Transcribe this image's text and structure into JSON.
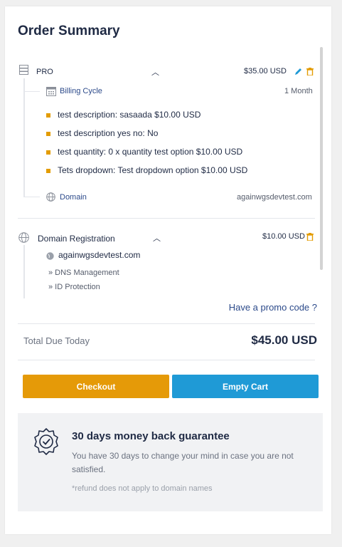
{
  "title": "Order Summary",
  "products": [
    {
      "name": "PRO",
      "price": "$35.00 USD",
      "icon": "server-icon",
      "billing_label": "Billing Cycle",
      "billing_value": "1 Month",
      "options": [
        "test description: sasaada $10.00 USD",
        "test description yes no: No",
        "test quantity: 0 x quantity test option $10.00 USD",
        "Tets dropdown: Test dropdown option $10.00 USD"
      ],
      "domain_label": "Domain",
      "domain_value": "againwgsdevtest.com"
    },
    {
      "name": "Domain Registration",
      "price": "$10.00 USD",
      "icon": "globe-icon",
      "domain": "againwgsdevtest.com",
      "addons": [
        "» DNS Management",
        "» ID Protection"
      ]
    }
  ],
  "promo_link": "Have a promo code ?",
  "total": {
    "label": "Total Due Today",
    "value": "$45.00 USD"
  },
  "buttons": {
    "checkout": "Checkout",
    "empty_cart": "Empty Cart"
  },
  "guarantee": {
    "title": "30 days money back guarantee",
    "text": "You have 30 days to change your mind in case you are not satisfied.",
    "note": "*refund does not apply to domain names"
  },
  "colors": {
    "accent_orange": "#e59a08",
    "accent_blue": "#1f9ad6",
    "dark_text": "#1f2a44",
    "link_blue": "#2c4a8a"
  }
}
